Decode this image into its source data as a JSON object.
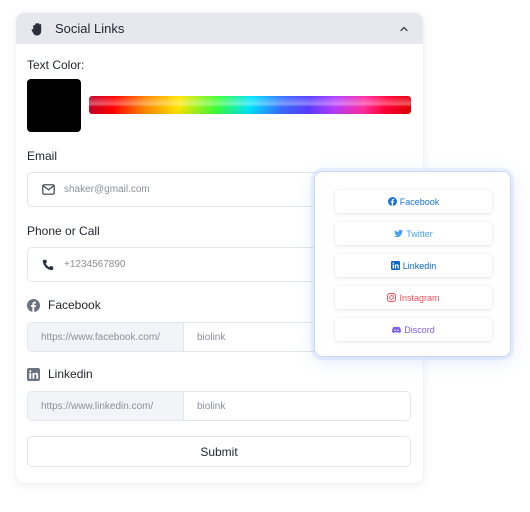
{
  "panel": {
    "title": "Social Links",
    "icons": {
      "header": "hand-icon",
      "collapse": "chevron-up-icon"
    }
  },
  "text_color": {
    "label": "Text Color:",
    "selected_color": "#000000"
  },
  "email": {
    "label": "Email",
    "placeholder": "shaker@gmail.com",
    "icon": "envelope-icon"
  },
  "phone": {
    "label": "Phone or Call",
    "placeholder": "+1234567890",
    "icon": "phone-icon"
  },
  "facebook": {
    "label": "Facebook",
    "prefix": "https://www.facebook.com/",
    "placeholder": "biolink",
    "icon": "facebook-icon"
  },
  "linkedin": {
    "label": "Linkedin",
    "prefix": "https://www.linkedin.com/",
    "placeholder": "biolink",
    "icon": "linkedin-icon"
  },
  "submit": {
    "label": "Submit"
  },
  "preview_buttons": [
    {
      "label": "Facebook",
      "color": "#1b74e4",
      "icon": "facebook-icon"
    },
    {
      "label": "Twitter",
      "color": "#4aa3f0",
      "icon": "twitter-icon"
    },
    {
      "label": "Linkedin",
      "color": "#0a66c2",
      "icon": "linkedin-icon"
    },
    {
      "label": "Instagram",
      "color": "#f0505c",
      "icon": "instagram-icon"
    },
    {
      "label": "Discord",
      "color": "#7c5cf0",
      "icon": "discord-icon"
    }
  ]
}
